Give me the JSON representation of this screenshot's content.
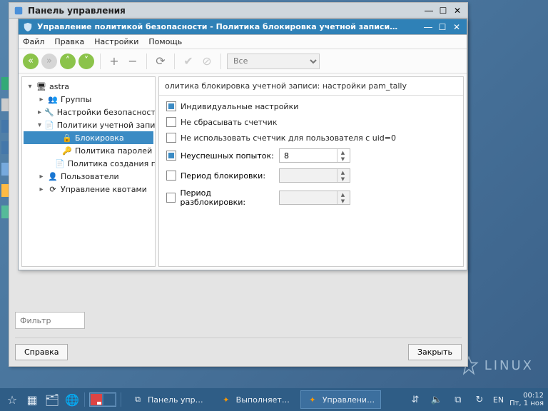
{
  "control_panel": {
    "title": "Панель управления",
    "filter_placeholder": "Фильтр",
    "help_btn": "Справка",
    "close_btn": "Закрыть"
  },
  "policy_window": {
    "title": "Управление политикой безопасности - Политика блокировка учетной записи…",
    "menu": [
      "Файл",
      "Правка",
      "Настройки",
      "Помощь"
    ],
    "combo": "Все",
    "tree": {
      "root": "astra",
      "groups": "Группы",
      "sec": "Настройки безопасности",
      "acct": "Политики учетной записи",
      "block": "Блокировка",
      "pwd": "Политика паролей",
      "create": "Политика создания пол…",
      "users": "Пользователи",
      "quota": "Управление квотами"
    },
    "form": {
      "header": "олитика блокировка учетной записи: настройки pam_tally",
      "indiv": "Индивидуальные настройки",
      "noreset": "Не сбрасывать счетчик",
      "nouid0": "Не использовать счетчик для пользователя с uid=0",
      "fails": "Неуспешных попыток:",
      "fails_val": "8",
      "lock": "Период блокировки:",
      "unlock": "Период разблокировки:"
    }
  },
  "taskbar": {
    "t1": "Панель упр…",
    "t2": "Выполняет…",
    "t3": "Управлени…",
    "lang": "EN",
    "time": "00:12",
    "date": "Пт, 1 ноя"
  },
  "corner_logo": "LINUX"
}
